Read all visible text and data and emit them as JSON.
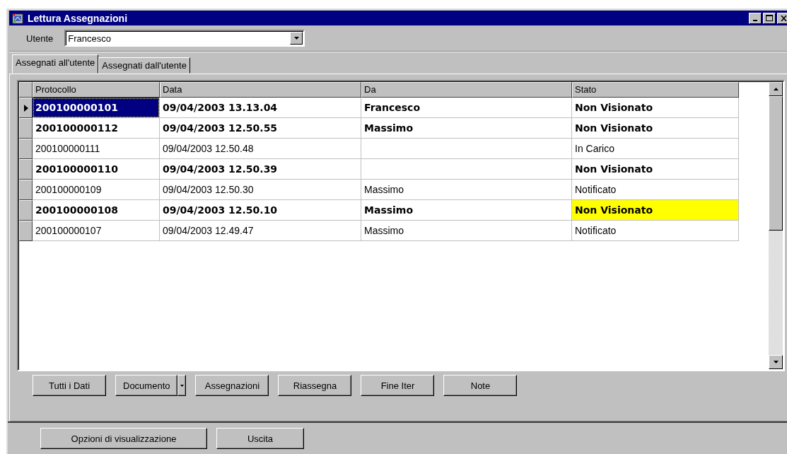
{
  "window": {
    "title": "Lettura Assegnazioni"
  },
  "user_field": {
    "label": "Utente",
    "value": "Francesco"
  },
  "tabs": [
    {
      "label": "Assegnati all'utente",
      "selected": true
    },
    {
      "label": "Assegnati dall'utente",
      "selected": false
    }
  ],
  "table": {
    "columns": [
      "Protocollo",
      "Data",
      "Da",
      "Stato"
    ],
    "rows": [
      {
        "cells": [
          "200100000101",
          "09/04/2003 13.13.04",
          "Francesco",
          "Non Visionato"
        ],
        "bold": true,
        "selected": true,
        "highlighted": false
      },
      {
        "cells": [
          "200100000112",
          "09/04/2003 12.50.55",
          "Massimo",
          "Non Visionato"
        ],
        "bold": true,
        "selected": false,
        "highlighted": false
      },
      {
        "cells": [
          "200100000111",
          "09/04/2003 12.50.48",
          "",
          "In Carico"
        ],
        "bold": false,
        "selected": false,
        "highlighted": false
      },
      {
        "cells": [
          "200100000110",
          "09/04/2003 12.50.39",
          "",
          "Non Visionato"
        ],
        "bold": true,
        "selected": false,
        "highlighted": false
      },
      {
        "cells": [
          "200100000109",
          "09/04/2003 12.50.30",
          "Massimo",
          "Notificato"
        ],
        "bold": false,
        "selected": false,
        "highlighted": false
      },
      {
        "cells": [
          "200100000108",
          "09/04/2003 12.50.10",
          "Massimo",
          "Non Visionato"
        ],
        "bold": true,
        "selected": false,
        "highlighted": true
      },
      {
        "cells": [
          "200100000107",
          "09/04/2003 12.49.47",
          "Massimo",
          "Notificato"
        ],
        "bold": false,
        "selected": false,
        "highlighted": false
      }
    ]
  },
  "action_buttons": [
    {
      "label": "Tutti i Dati",
      "kind": "plain"
    },
    {
      "label": "Documento",
      "kind": "split"
    },
    {
      "label": "Assegnazioni",
      "kind": "plain"
    },
    {
      "label": "Riassegna",
      "kind": "plain"
    },
    {
      "label": "Fine Iter",
      "kind": "plain"
    },
    {
      "label": "Note",
      "kind": "plain"
    }
  ],
  "bottom_buttons": [
    {
      "label": "Opzioni di visualizzazione"
    },
    {
      "label": "Uscita"
    }
  ]
}
